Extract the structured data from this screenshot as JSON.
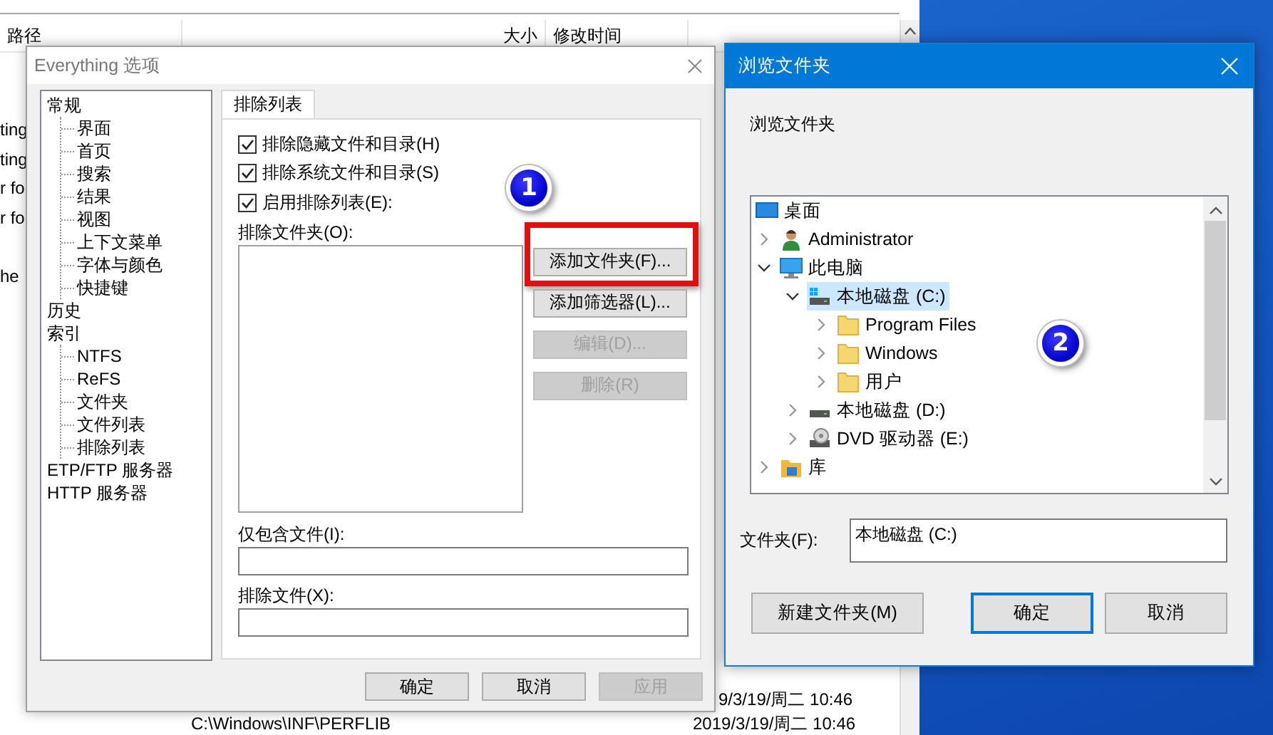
{
  "background_window": {
    "columns": [
      {
        "label": "路径"
      },
      {
        "label": "大小"
      },
      {
        "label": "修改时间"
      }
    ],
    "cut_names": [
      "ting",
      "ting",
      "r fo",
      "r fo",
      "he"
    ],
    "rows": [
      {
        "modified": "9/3/19/周二 10:46"
      },
      {
        "path": "C:\\Windows\\INF\\PERFLIB",
        "modified": "2019/3/19/周二 10:46"
      }
    ]
  },
  "options_dialog": {
    "title": "Everything 选项",
    "tree": [
      {
        "label": "常规",
        "children": [
          {
            "label": "界面"
          },
          {
            "label": "首页"
          },
          {
            "label": "搜索"
          },
          {
            "label": "结果"
          },
          {
            "label": "视图"
          },
          {
            "label": "上下文菜单"
          },
          {
            "label": "字体与颜色"
          },
          {
            "label": "快捷键"
          }
        ]
      },
      {
        "label": "历史"
      },
      {
        "label": "索引",
        "children": [
          {
            "label": "NTFS"
          },
          {
            "label": "ReFS"
          },
          {
            "label": "文件夹"
          },
          {
            "label": "文件列表"
          },
          {
            "label": "排除列表"
          }
        ]
      },
      {
        "label": "ETP/FTP 服务器"
      },
      {
        "label": "HTTP 服务器"
      }
    ],
    "tabs": [
      {
        "label": "排除列表",
        "selected": true
      }
    ],
    "checkboxes": [
      {
        "label": "排除隐藏文件和目录(H)",
        "checked": true
      },
      {
        "label": "排除系统文件和目录(S)",
        "checked": true
      },
      {
        "label": "启用排除列表(E):",
        "checked": true
      }
    ],
    "exclude_folders_label": "排除文件夹(O):",
    "buttons": [
      {
        "label": "添加文件夹(F)...",
        "disabled": false,
        "highlighted": true
      },
      {
        "label": "添加筛选器(L)...",
        "disabled": false,
        "highlighted": false
      },
      {
        "label": "编辑(D)...",
        "disabled": true,
        "highlighted": false
      },
      {
        "label": "删除(R)",
        "disabled": true,
        "highlighted": false
      }
    ],
    "include_files": {
      "label": "仅包含文件(I):"
    },
    "exclude_files": {
      "label": "排除文件(X):"
    },
    "footer_buttons": [
      {
        "label": "确定",
        "disabled": false
      },
      {
        "label": "取消",
        "disabled": false
      },
      {
        "label": "应用",
        "disabled": true
      }
    ]
  },
  "browse_dialog": {
    "title": "浏览文件夹",
    "description": "浏览文件夹",
    "tree": [
      {
        "label": "桌面",
        "kind": "desktop",
        "selected": false
      },
      {
        "label": "Administrator",
        "kind": "user",
        "expanded": false,
        "selected": false
      },
      {
        "label": "此电脑",
        "kind": "computer",
        "expanded": true,
        "selected": false,
        "children": [
          {
            "label": "本地磁盘 (C:)",
            "kind": "system-drive",
            "expanded": true,
            "selected": true,
            "children": [
              {
                "label": "Program Files",
                "kind": "folder",
                "expanded": false,
                "selected": false
              },
              {
                "label": "Windows",
                "kind": "folder",
                "expanded": false,
                "selected": false
              },
              {
                "label": "用户",
                "kind": "folder",
                "expanded": false,
                "selected": false
              }
            ]
          },
          {
            "label": "本地磁盘 (D:)",
            "kind": "drive",
            "expanded": false,
            "selected": false
          },
          {
            "label": "DVD 驱动器 (E:)",
            "kind": "dvd",
            "expanded": false,
            "selected": false
          }
        ]
      },
      {
        "label": "库",
        "kind": "library",
        "expanded": false,
        "selected": false
      }
    ],
    "folder": {
      "label": "文件夹(F):",
      "value": "本地磁盘 (C:)"
    },
    "buttons": [
      {
        "label": "新建文件夹(M)",
        "default": false
      },
      {
        "label": "确定",
        "default": true
      },
      {
        "label": "取消",
        "default": false
      }
    ]
  },
  "callouts": [
    {
      "label": "1"
    },
    {
      "label": "2"
    }
  ]
}
